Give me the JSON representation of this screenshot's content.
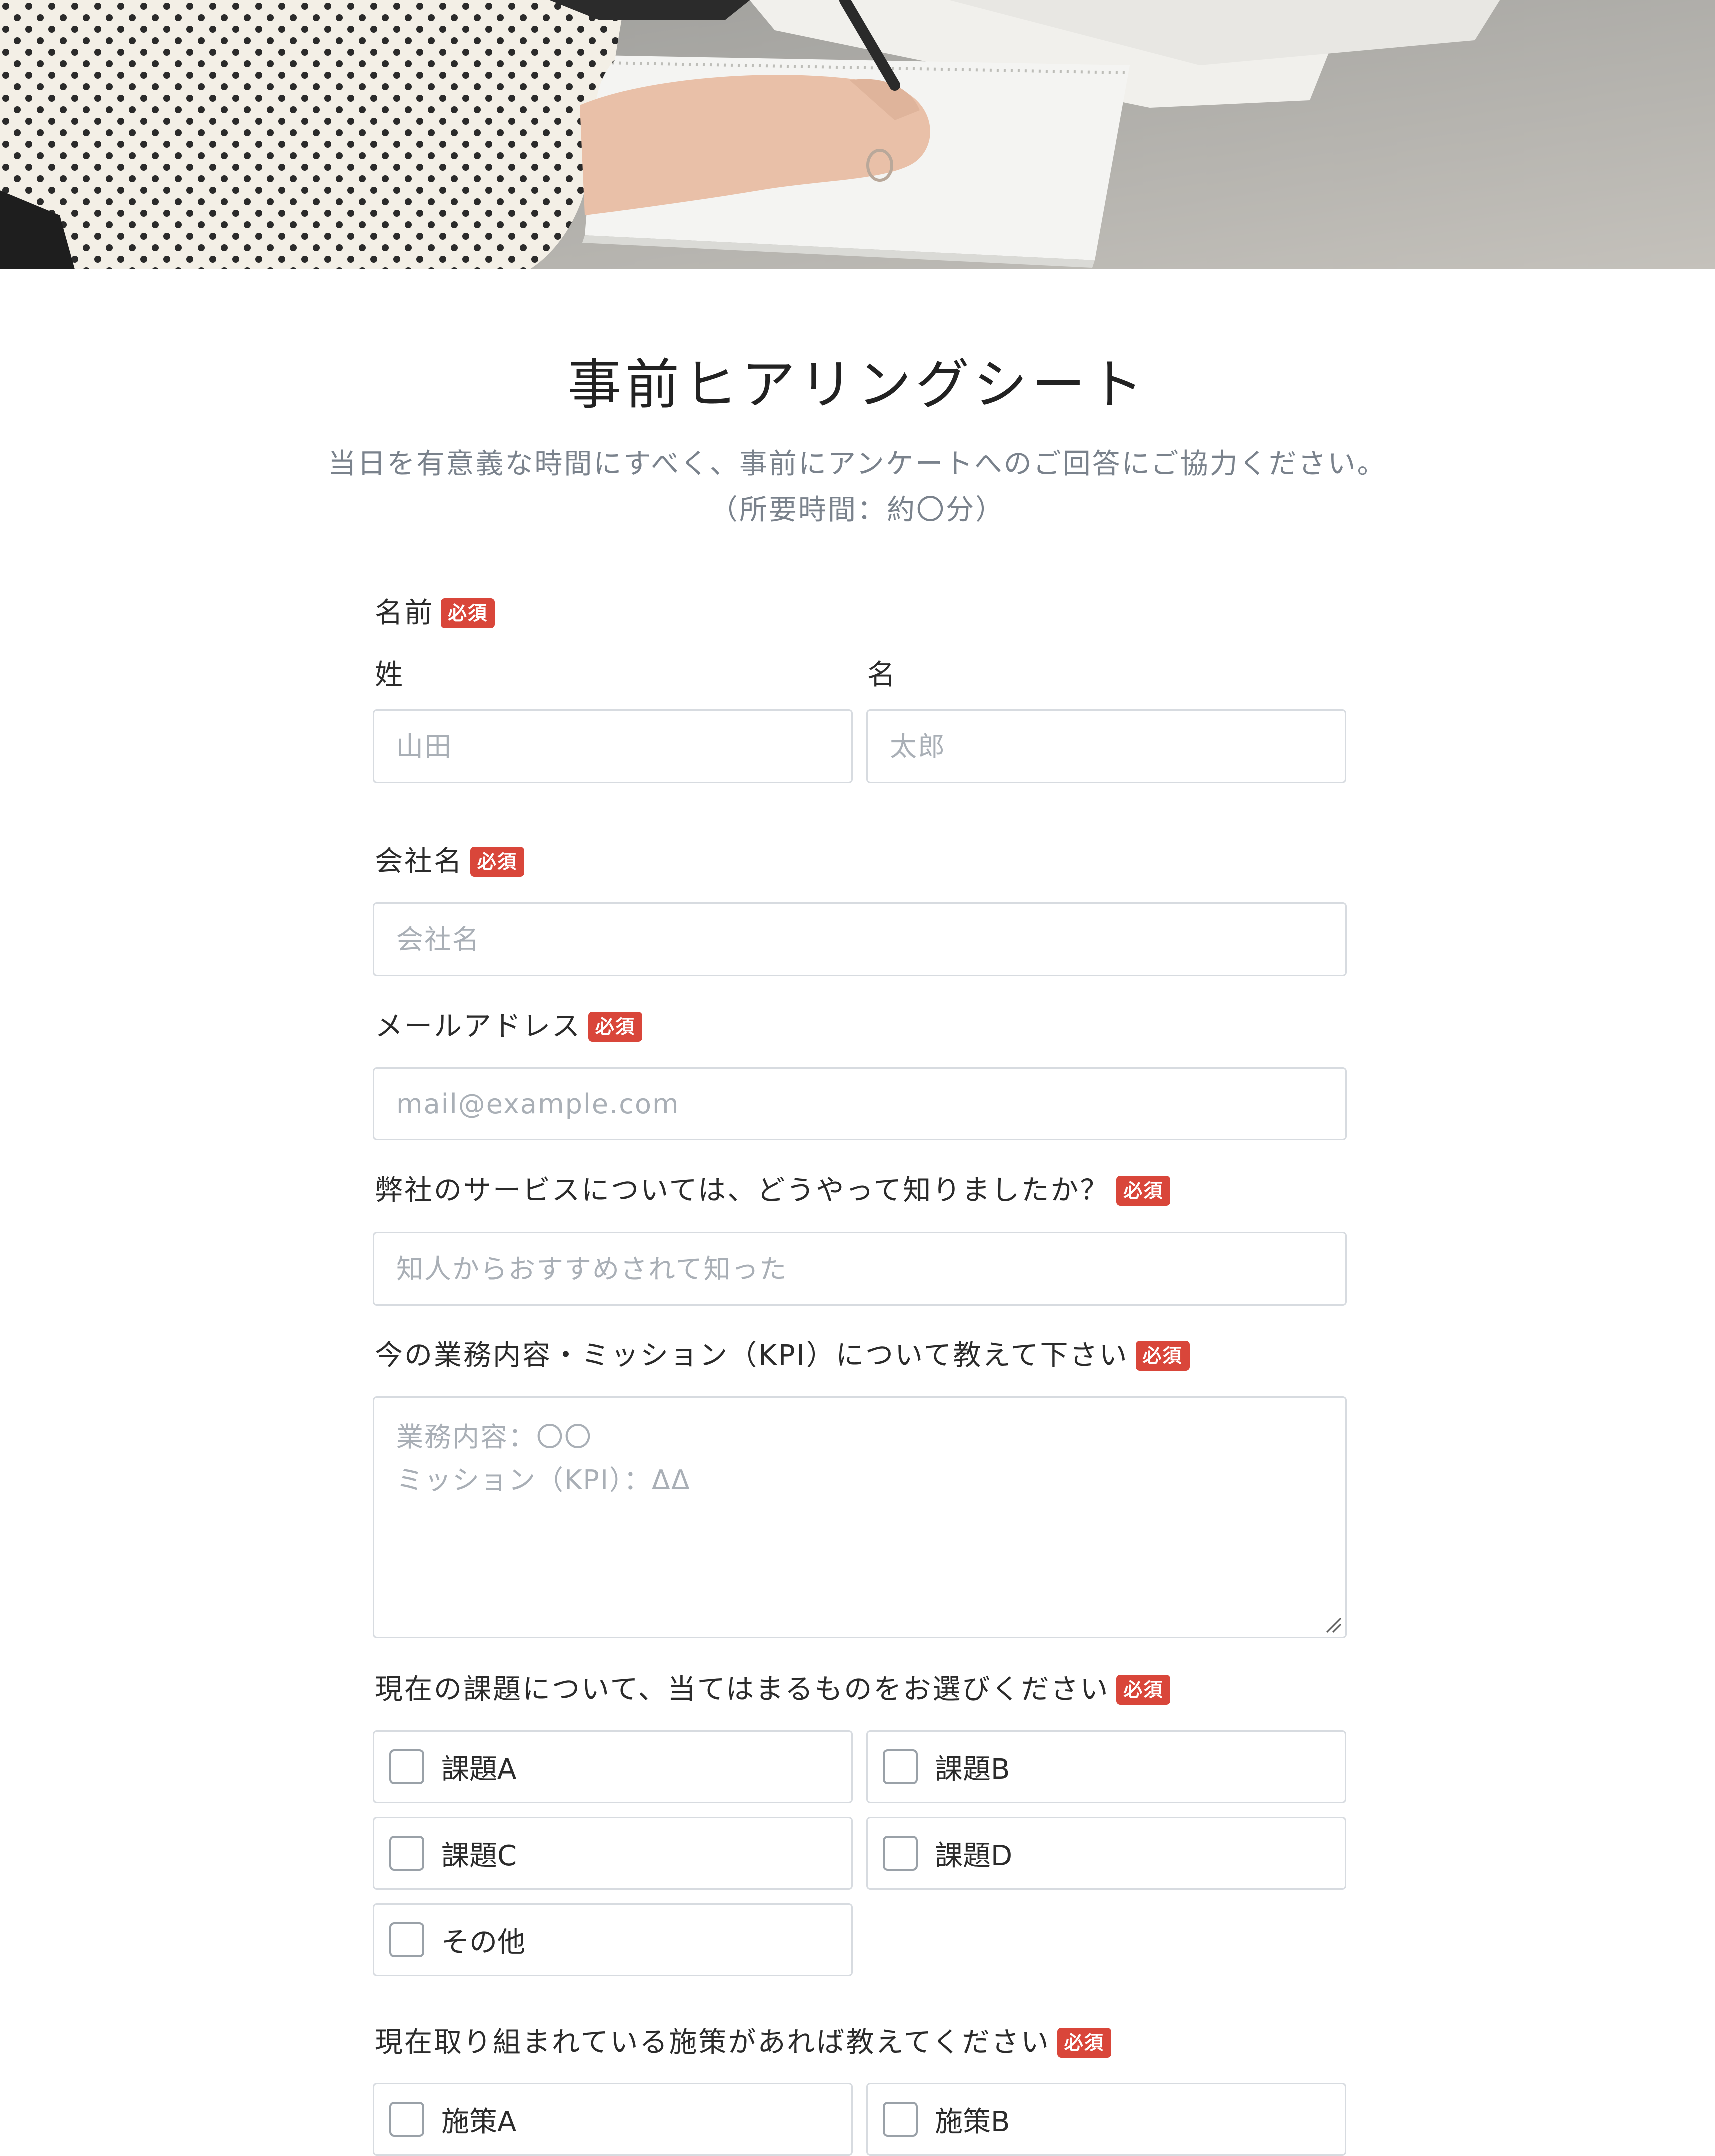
{
  "header": {
    "image": "hero-photo: person in polka-dot blouse writing in a notebook"
  },
  "form": {
    "title": "事前ヒアリングシート",
    "description_line1": "当日を有意義な時間にすべく、事前にアンケートへのご回答にご協力ください。",
    "description_line2": "（所要時間：約〇分）",
    "required_badge": "必須",
    "name": {
      "label": "名前",
      "last_label": "姓",
      "last_placeholder": "山田",
      "first_label": "名",
      "first_placeholder": "太郎"
    },
    "company": {
      "label": "会社名",
      "placeholder": "会社名"
    },
    "email": {
      "label": "メールアドレス",
      "placeholder": "mail@example.com"
    },
    "source": {
      "label": "弊社のサービスについては、どうやって知りましたか？",
      "placeholder": "知人からおすすめされて知った"
    },
    "mission": {
      "label": "今の業務内容・ミッション（KPI）について教えて下さい",
      "placeholder": "業務内容：〇〇\nミッション（KPI）：ΔΔ"
    },
    "issues": {
      "label": "現在の課題について、当てはまるものをお選びください",
      "options": [
        "課題A",
        "課題B",
        "課題C",
        "課題D",
        "その他"
      ]
    },
    "measures": {
      "label": "現在取り組まれている施策があれば教えてください",
      "options": [
        "施策A",
        "施策B"
      ]
    }
  }
}
